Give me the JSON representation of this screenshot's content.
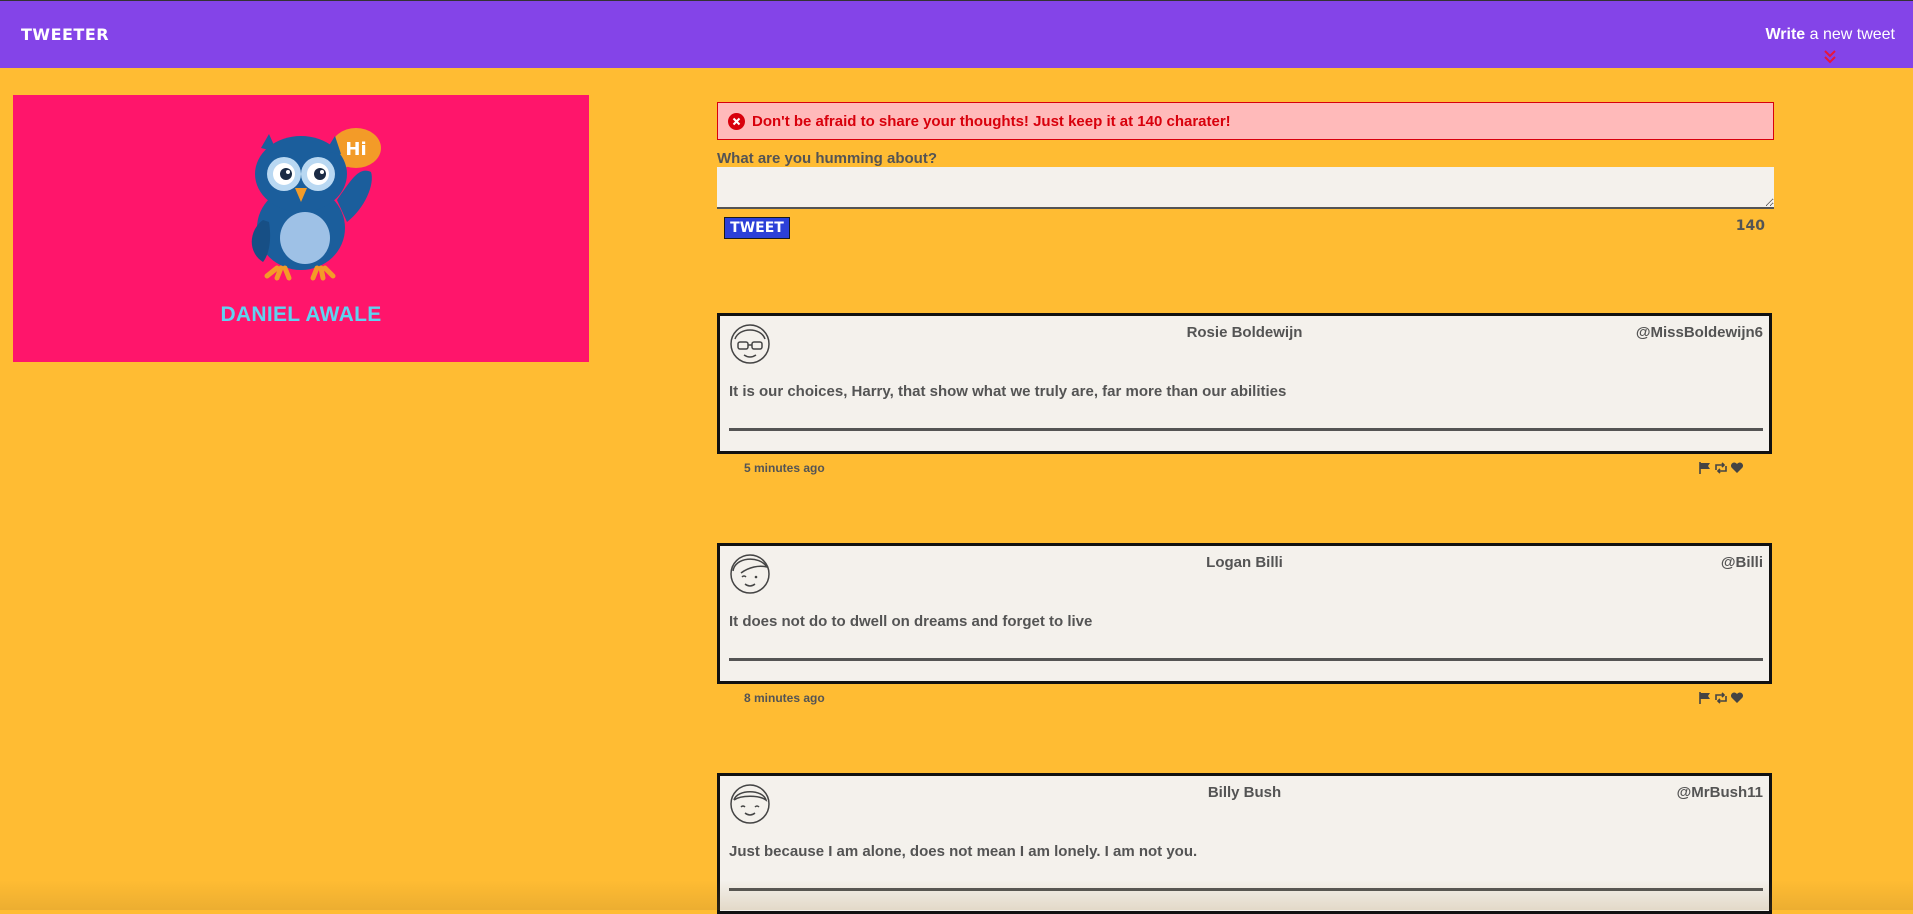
{
  "nav": {
    "brand": "TWEETER",
    "compose_bold": "Write",
    "compose_rest": " a new tweet"
  },
  "profile": {
    "name": "DANIEL AWALE",
    "bubble_text": "Hi"
  },
  "composer": {
    "error_message": "Don't be afraid to share your thoughts! Just keep it at 140 charater!",
    "prompt": "What are you humming about?",
    "input_value": "",
    "submit_label": "TWEET",
    "char_count": "140"
  },
  "tweets": [
    {
      "name": "Rosie Boldewijn",
      "handle": "@MissBoldewijn6",
      "text": "It is our choices, Harry, that show what we truly are, far more than our abilities",
      "time": "5 minutes ago"
    },
    {
      "name": "Logan Billi",
      "handle": "@Billi",
      "text": "It does not do to dwell on dreams and forget to live",
      "time": "8 minutes ago"
    },
    {
      "name": "Billy Bush",
      "handle": "@MrBush11",
      "text": "Just because I am alone, does not mean I am lonely. I am not you.",
      "time": ""
    }
  ],
  "icons": {
    "flag": "flag-icon",
    "retweet": "retweet-icon",
    "like": "heart-icon"
  },
  "colors": {
    "nav_bg": "#8444E8",
    "page_bg": "#FFBC33",
    "profile_bg": "#FF156B",
    "name_color": "#5FD3F0",
    "error_bg": "#FFBABA",
    "error_text": "#D8000C",
    "tweet_button": "#2C40D8",
    "card_bg": "#F4F1EC"
  }
}
